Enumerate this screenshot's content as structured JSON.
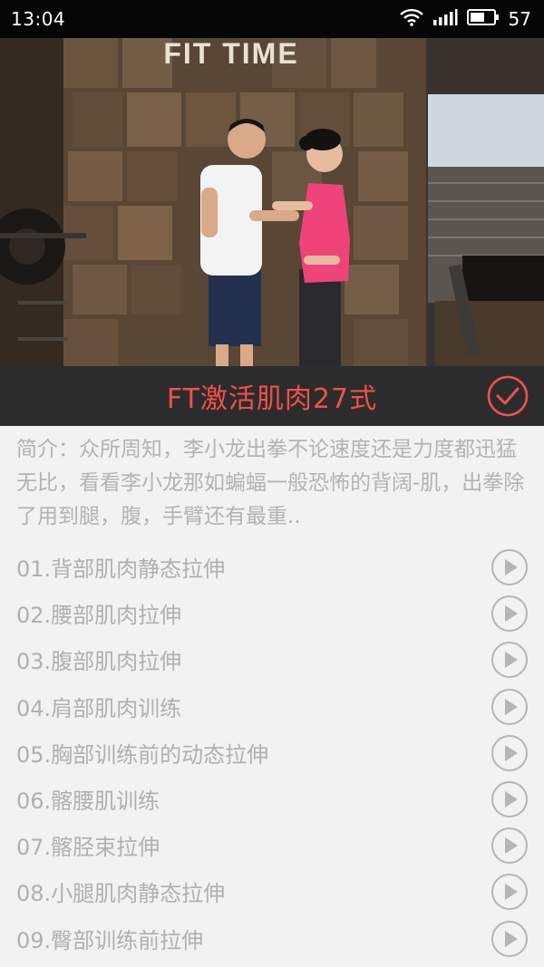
{
  "status_bar": {
    "time": "13:04",
    "battery_level": "57",
    "icons": [
      "wifi-icon",
      "signal-icon",
      "battery-icon"
    ]
  },
  "hero": {
    "image": "fitness-trainer-stretching-photo",
    "logo_text": "FIT TIME"
  },
  "header": {
    "title": "FT激活肌肉27式",
    "check_icon": "check-circle-icon",
    "accent_color": "#f0504a"
  },
  "intro": {
    "text": "简介：众所周知，李小龙出拳不论速度还是力度都迅猛无比，看看李小龙那如蝙蝠一般恐怖的背阔-肌，出拳除了用到腿，腹，手臂还有最重.."
  },
  "lessons": [
    {
      "label": "01.背部肌肉静态拉伸",
      "icon": "play-icon"
    },
    {
      "label": "02.腰部肌肉拉伸",
      "icon": "play-icon"
    },
    {
      "label": "03.腹部肌肉拉伸",
      "icon": "play-icon"
    },
    {
      "label": "04.肩部肌肉训练",
      "icon": "play-icon"
    },
    {
      "label": "05.胸部训练前的动态拉伸",
      "icon": "play-icon"
    },
    {
      "label": "06.髂腰肌训练",
      "icon": "play-icon"
    },
    {
      "label": "07.髂胫束拉伸",
      "icon": "play-icon"
    },
    {
      "label": "08.小腿肌肉静态拉伸",
      "icon": "play-icon"
    },
    {
      "label": "09.臀部训练前拉伸",
      "icon": "play-icon"
    }
  ]
}
